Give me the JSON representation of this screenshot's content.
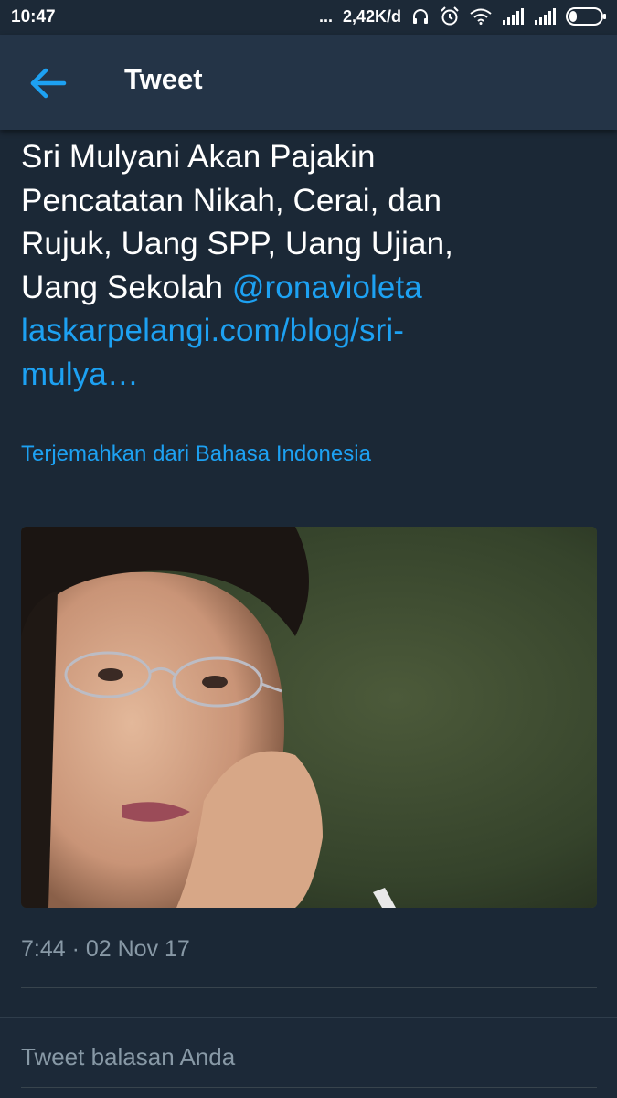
{
  "status_bar": {
    "time": "10:47",
    "dots": "...",
    "speed": "2,42K/d",
    "icons": [
      "headphones-icon",
      "alarm-icon",
      "wifi-icon",
      "signal-icon",
      "signal-icon",
      "battery-icon"
    ]
  },
  "header": {
    "back_icon": "arrow-left-icon",
    "title": "Tweet",
    "accent": "#1da1f2"
  },
  "tweet": {
    "text_lines": [
      "Sri Mulyani Akan Pajakin",
      "Pencatatan Nikah, Cerai, dan",
      "Rujuk, Uang SPP, Uang Ujian,",
      "Uang Sekolah "
    ],
    "mention": "@ronavioleta",
    "link_lines": [
      "laskarpelangi.com/blog/sri-",
      "mulya…"
    ],
    "translate_label": "Terjemahkan dari Bahasa Indonesia",
    "timestamp": "7:44 · 02 Nov 17"
  },
  "reply": {
    "placeholder": "Tweet balasan Anda"
  }
}
